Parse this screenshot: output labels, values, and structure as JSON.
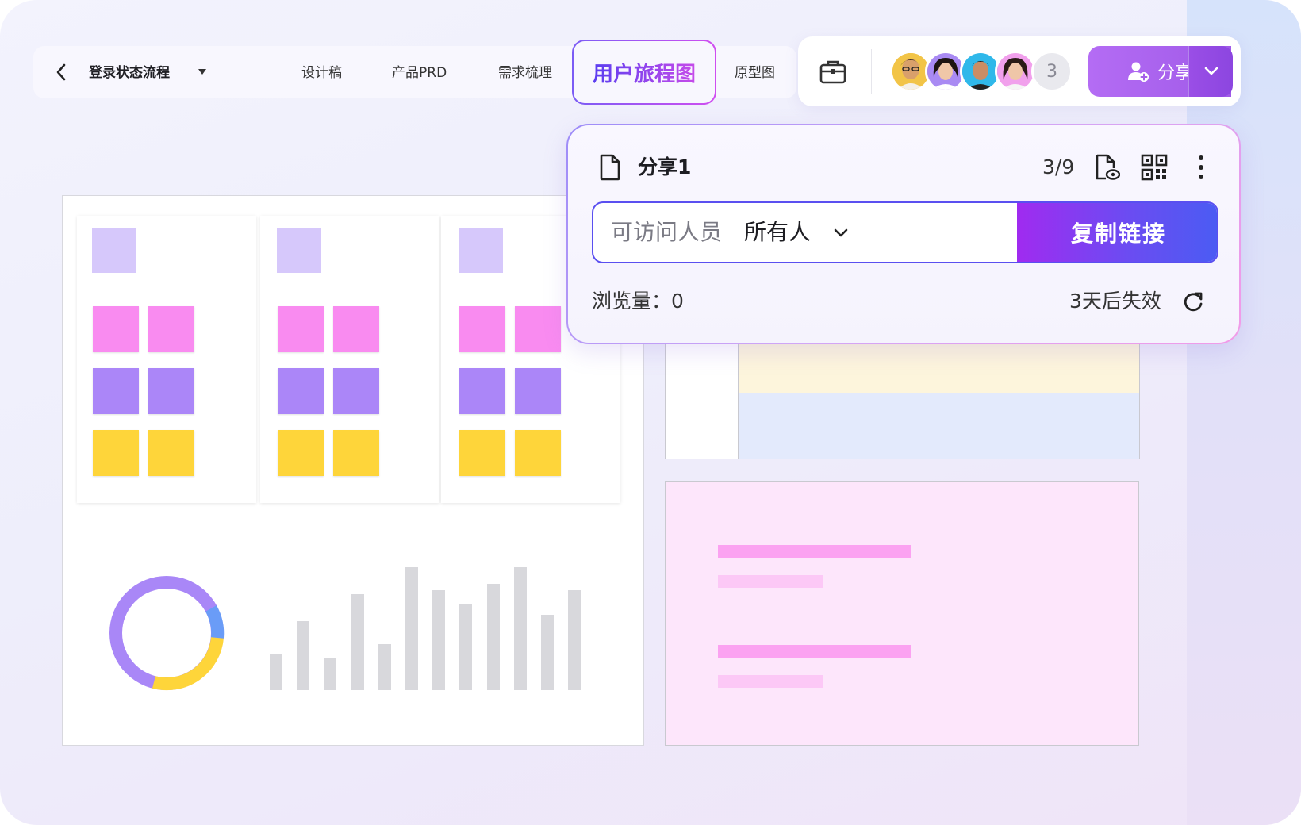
{
  "nav": {
    "back_icon": "chevron-left-icon",
    "title": "登录状态流程",
    "tabs": [
      {
        "label": "设计稿"
      },
      {
        "label": "产品PRD"
      },
      {
        "label": "需求梳理"
      },
      {
        "label": "用户旅程图"
      },
      {
        "label": "原型图"
      }
    ],
    "active_tab": "用户旅程图"
  },
  "toolbar": {
    "tool_icon": "briefcase-icon",
    "collaborators_extra": "3",
    "share_label": "分享",
    "share_icon": "add-user-icon"
  },
  "share_popup": {
    "title": "分享1",
    "count": "3/9",
    "access_label": "可访问人员",
    "access_value": "所有人",
    "copy_label": "复制链接",
    "views_label": "浏览量：0",
    "expire_label": "3天后失效"
  },
  "colors": {
    "accent_purple": "#7b5cf5",
    "accent_pink": "#d04ef0",
    "sticky_pink": "#f98bf0",
    "sticky_purple": "#ab86f8",
    "sticky_yellow": "#fed53a",
    "sticky_lavender": "#d6c8fb"
  }
}
